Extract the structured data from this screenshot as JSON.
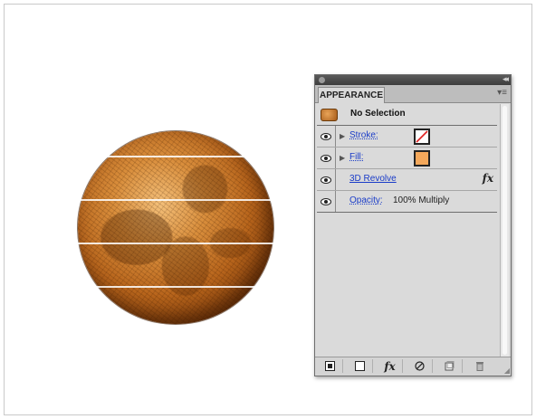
{
  "panel": {
    "tab_label": "APPEARANCE",
    "collapse_glyph": "◂◂",
    "menu_glyph": "▾≡"
  },
  "rows": {
    "selection": {
      "label": "No Selection"
    },
    "stroke": {
      "label": "Stroke:",
      "swatch": "none"
    },
    "fill": {
      "label": "Fill:",
      "swatch_color": "#f4a85b"
    },
    "effect": {
      "label": "3D Revolve",
      "fx_icon": "fx"
    },
    "opacity": {
      "label": "Opacity:",
      "value": "100% Multiply"
    }
  },
  "toolbar": {
    "buttons": [
      {
        "name": "add-new-stroke-button",
        "icon": "square-filled-icon"
      },
      {
        "name": "add-new-fill-button",
        "icon": "square-outline-icon"
      },
      {
        "name": "add-new-effect-button",
        "icon": "fx-icon",
        "glyph": "fx"
      },
      {
        "name": "clear-appearance-button",
        "icon": "no-icon"
      },
      {
        "name": "duplicate-item-button",
        "icon": "duplicate-icon"
      },
      {
        "name": "delete-item-button",
        "icon": "trash-icon"
      }
    ]
  },
  "colors": {
    "link_blue": "#1a3cc8",
    "globe_orange": "#d98e3c",
    "panel_bg": "#dadada"
  }
}
